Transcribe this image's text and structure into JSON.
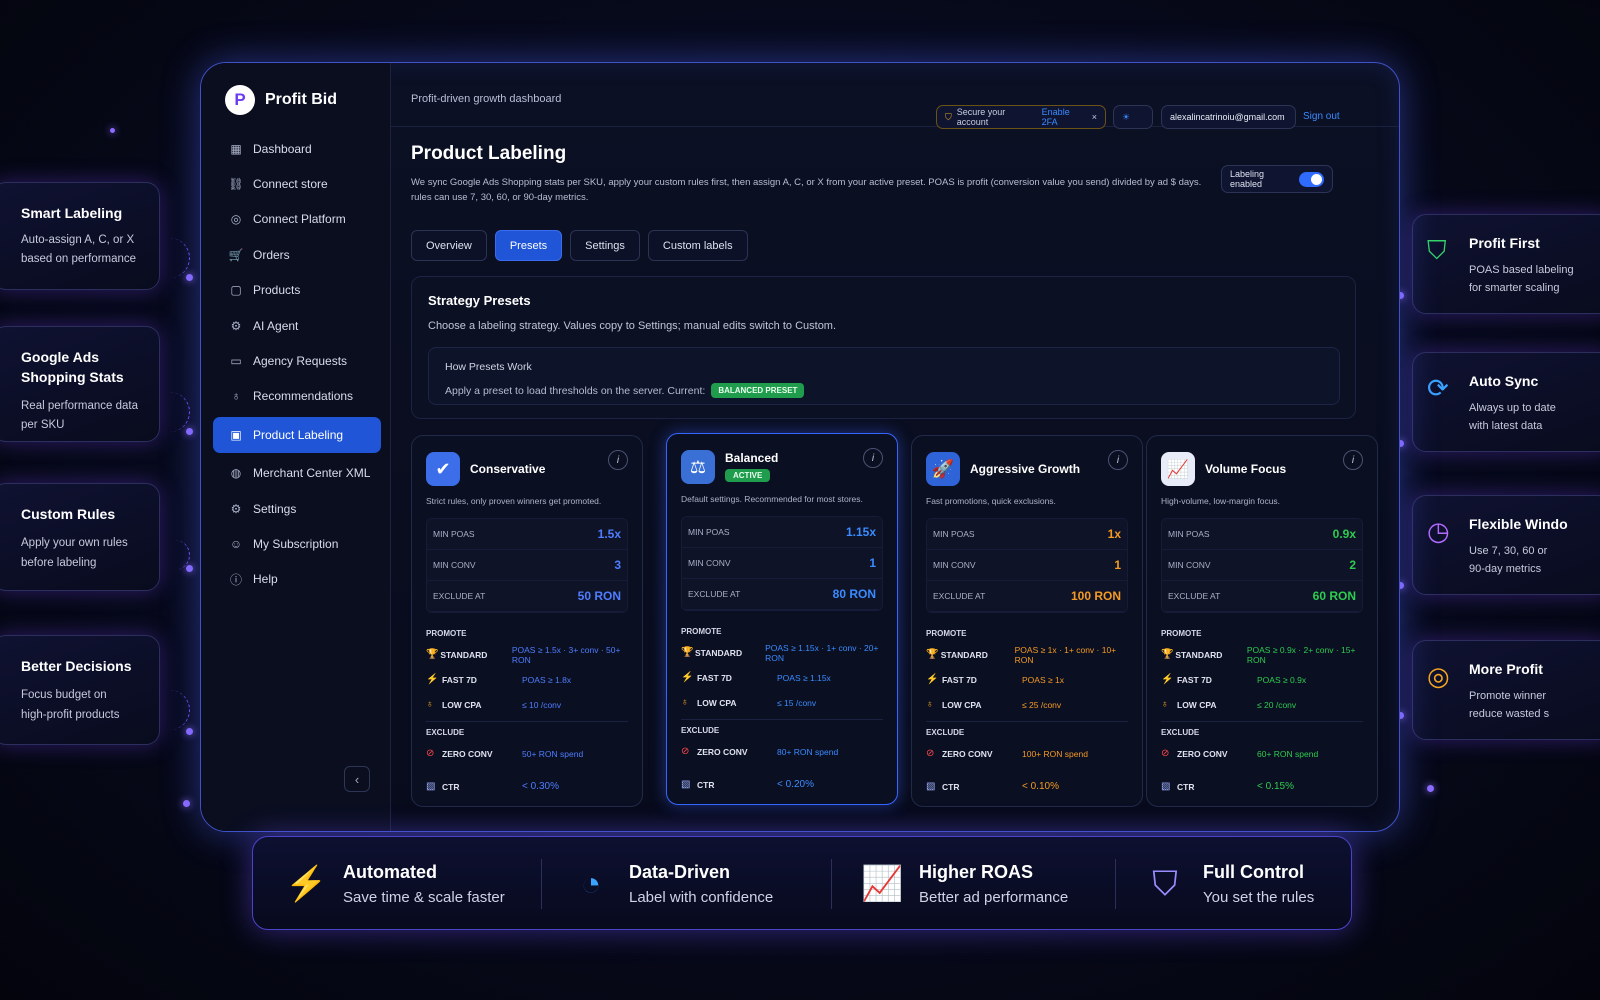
{
  "brand": {
    "name": "Profit Bid",
    "logo": "P"
  },
  "nav": [
    {
      "label": "Dashboard",
      "icon": "dashboard-icon",
      "glyph": "▦"
    },
    {
      "label": "Connect store",
      "icon": "link-icon",
      "glyph": "⛓"
    },
    {
      "label": "Connect Platform",
      "icon": "platform-icon",
      "glyph": "◎"
    },
    {
      "label": "Orders",
      "icon": "cart-icon",
      "glyph": "🛒"
    },
    {
      "label": "Products",
      "icon": "box-icon",
      "glyph": "▢"
    },
    {
      "label": "AI Agent",
      "icon": "ai-icon",
      "glyph": "⚙"
    },
    {
      "label": "Agency Requests",
      "icon": "briefcase-icon",
      "glyph": "▭"
    },
    {
      "label": "Recommendations",
      "icon": "bulb-icon",
      "glyph": "♁"
    },
    {
      "label": "Product Labeling",
      "icon": "label-icon",
      "glyph": "▣",
      "active": true
    },
    {
      "label": "Merchant Center XML",
      "icon": "globe-icon",
      "glyph": "◍"
    },
    {
      "label": "Settings",
      "icon": "gear-icon",
      "glyph": "⚙"
    },
    {
      "label": "My Subscription",
      "icon": "user-icon",
      "glyph": "☺"
    },
    {
      "label": "Help",
      "icon": "help-icon",
      "glyph": "ⓘ"
    }
  ],
  "topbar": {
    "subtitle": "Profit-driven growth dashboard",
    "security_text": "Secure your account",
    "security_link": "Enable 2FA",
    "email": "alexalincatrinoiu@gmail.com",
    "signout": "Sign out"
  },
  "page": {
    "title": "Product Labeling",
    "description": "We sync Google Ads Shopping stats per SKU, apply your custom rules first, then assign A, C, or X from your active preset. POAS is profit (conversion value you send) divided by ad $ days. rules can use 7, 30, 60, or 90-day metrics.",
    "toggle_label": "Labeling enabled",
    "tabs": [
      "Overview",
      "Presets",
      "Settings",
      "Custom labels"
    ],
    "active_tab": "Presets"
  },
  "strategy": {
    "title": "Strategy Presets",
    "description": "Choose a labeling strategy. Values copy to Settings; manual edits switch to Custom.",
    "how_title": "How Presets Work",
    "how_text": "Apply a preset to load thresholds on the server. Current:",
    "current_badge": "BALANCED PRESET"
  },
  "presets": [
    {
      "name": "Conservative",
      "desc": "Strict rules, only proven winners get promoted.",
      "color": "#4f7dff",
      "icon": "shield-icon",
      "glyph": "✔",
      "iconbg": "#3b6ee8",
      "min_poas": "1.5x",
      "min_conv": "3",
      "exclude_at": "50 RON",
      "standard": "POAS ≥ 1.5x · 3+ conv · 50+ RON",
      "fast": "POAS ≥ 1.8x",
      "low_cpa": "≤ 10 /conv",
      "zero_conv": "50+ RON spend",
      "ctr": "< 0.30%"
    },
    {
      "name": "Balanced",
      "desc": "Default settings. Recommended for most stores.",
      "color": "#3a8bff",
      "icon": "scale-icon",
      "glyph": "⚖",
      "iconbg": "#3a6fd6",
      "active": "ACTIVE",
      "min_poas": "1.15x",
      "min_conv": "1",
      "exclude_at": "80 RON",
      "standard": "POAS ≥ 1.15x · 1+ conv · 20+ RON",
      "fast": "POAS ≥ 1.15x",
      "low_cpa": "≤ 15 /conv",
      "zero_conv": "80+ RON spend",
      "ctr": "< 0.20%"
    },
    {
      "name": "Aggressive Growth",
      "desc": "Fast promotions, quick exclusions.",
      "color": "#f59a23",
      "icon": "rocket-icon",
      "glyph": "🚀",
      "iconbg": "#2f63d8",
      "min_poas": "1x",
      "min_conv": "1",
      "exclude_at": "100 RON",
      "standard": "POAS ≥ 1x · 1+ conv · 10+ RON",
      "fast": "POAS ≥ 1x",
      "low_cpa": "≤ 25 /conv",
      "zero_conv": "100+ RON spend",
      "ctr": "< 0.10%"
    },
    {
      "name": "Volume Focus",
      "desc": "High-volume, low-margin focus.",
      "color": "#2ecc4f",
      "icon": "trend-icon",
      "glyph": "📈",
      "iconbg": "#e8ecf8",
      "min_poas": "0.9x",
      "min_conv": "2",
      "exclude_at": "60 RON",
      "standard": "POAS ≥ 0.9x · 2+ conv · 15+ RON",
      "fast": "POAS ≥ 0.9x",
      "low_cpa": "≤ 20 /conv",
      "zero_conv": "60+ RON spend",
      "ctr": "< 0.15%"
    }
  ],
  "labels": {
    "min_poas": "MIN POAS",
    "min_conv": "MIN CONV",
    "exclude_at": "EXCLUDE AT",
    "promote": "PROMOTE",
    "exclude": "EXCLUDE",
    "standard": "STANDARD",
    "fast": "FAST 7D",
    "low_cpa": "LOW CPA",
    "zero_conv": "ZERO CONV",
    "ctr": "CTR"
  },
  "left_features": [
    {
      "title": "Smart Labeling",
      "desc1": "Auto-assign A, C, or X",
      "desc2": "based on performance"
    },
    {
      "title": "Google Ads",
      "title2": "Shopping Stats",
      "desc1": "Real performance data",
      "desc2": "per SKU"
    },
    {
      "title": "Custom Rules",
      "desc1": "Apply your own rules",
      "desc2": "before labeling"
    },
    {
      "title": "Better Decisions",
      "desc1": "Focus budget on",
      "desc2": "high-profit products"
    }
  ],
  "right_features": [
    {
      "title": "Profit First",
      "desc1": "POAS based labeling",
      "desc2": "for smarter scaling",
      "icon": "shield-check-icon",
      "glyph": "⛉",
      "color": "#35d46a"
    },
    {
      "title": "Auto Sync",
      "desc1": "Always up to date",
      "desc2": "with latest data",
      "icon": "sync-icon",
      "glyph": "⟳",
      "color": "#3aa2ff"
    },
    {
      "title": "Flexible Windo",
      "desc1": "Use 7, 30, 60 or",
      "desc2": "90-day metrics",
      "icon": "clock-icon",
      "glyph": "◷",
      "color": "#b26bff"
    },
    {
      "title": "More Profit",
      "desc1": "Promote winner",
      "desc2": "reduce wasted s",
      "icon": "target-icon",
      "glyph": "◎",
      "color": "#f5a623"
    }
  ],
  "bottom": [
    {
      "title": "Automated",
      "desc": "Save time & scale faster",
      "icon": "bolt-icon",
      "glyph": "⚡",
      "color": "#b26bff"
    },
    {
      "title": "Data-Driven",
      "desc": "Label with confidence",
      "icon": "pie-icon",
      "glyph": "◔",
      "color": "#3aa2ff"
    },
    {
      "title": "Higher ROAS",
      "desc": "Better ad performance",
      "icon": "chart-icon",
      "glyph": "📈",
      "color": "#7a6bff"
    },
    {
      "title": "Full Control",
      "desc": "You set the rules",
      "icon": "shield-icon",
      "glyph": "⛉",
      "color": "#9a8cff"
    }
  ]
}
